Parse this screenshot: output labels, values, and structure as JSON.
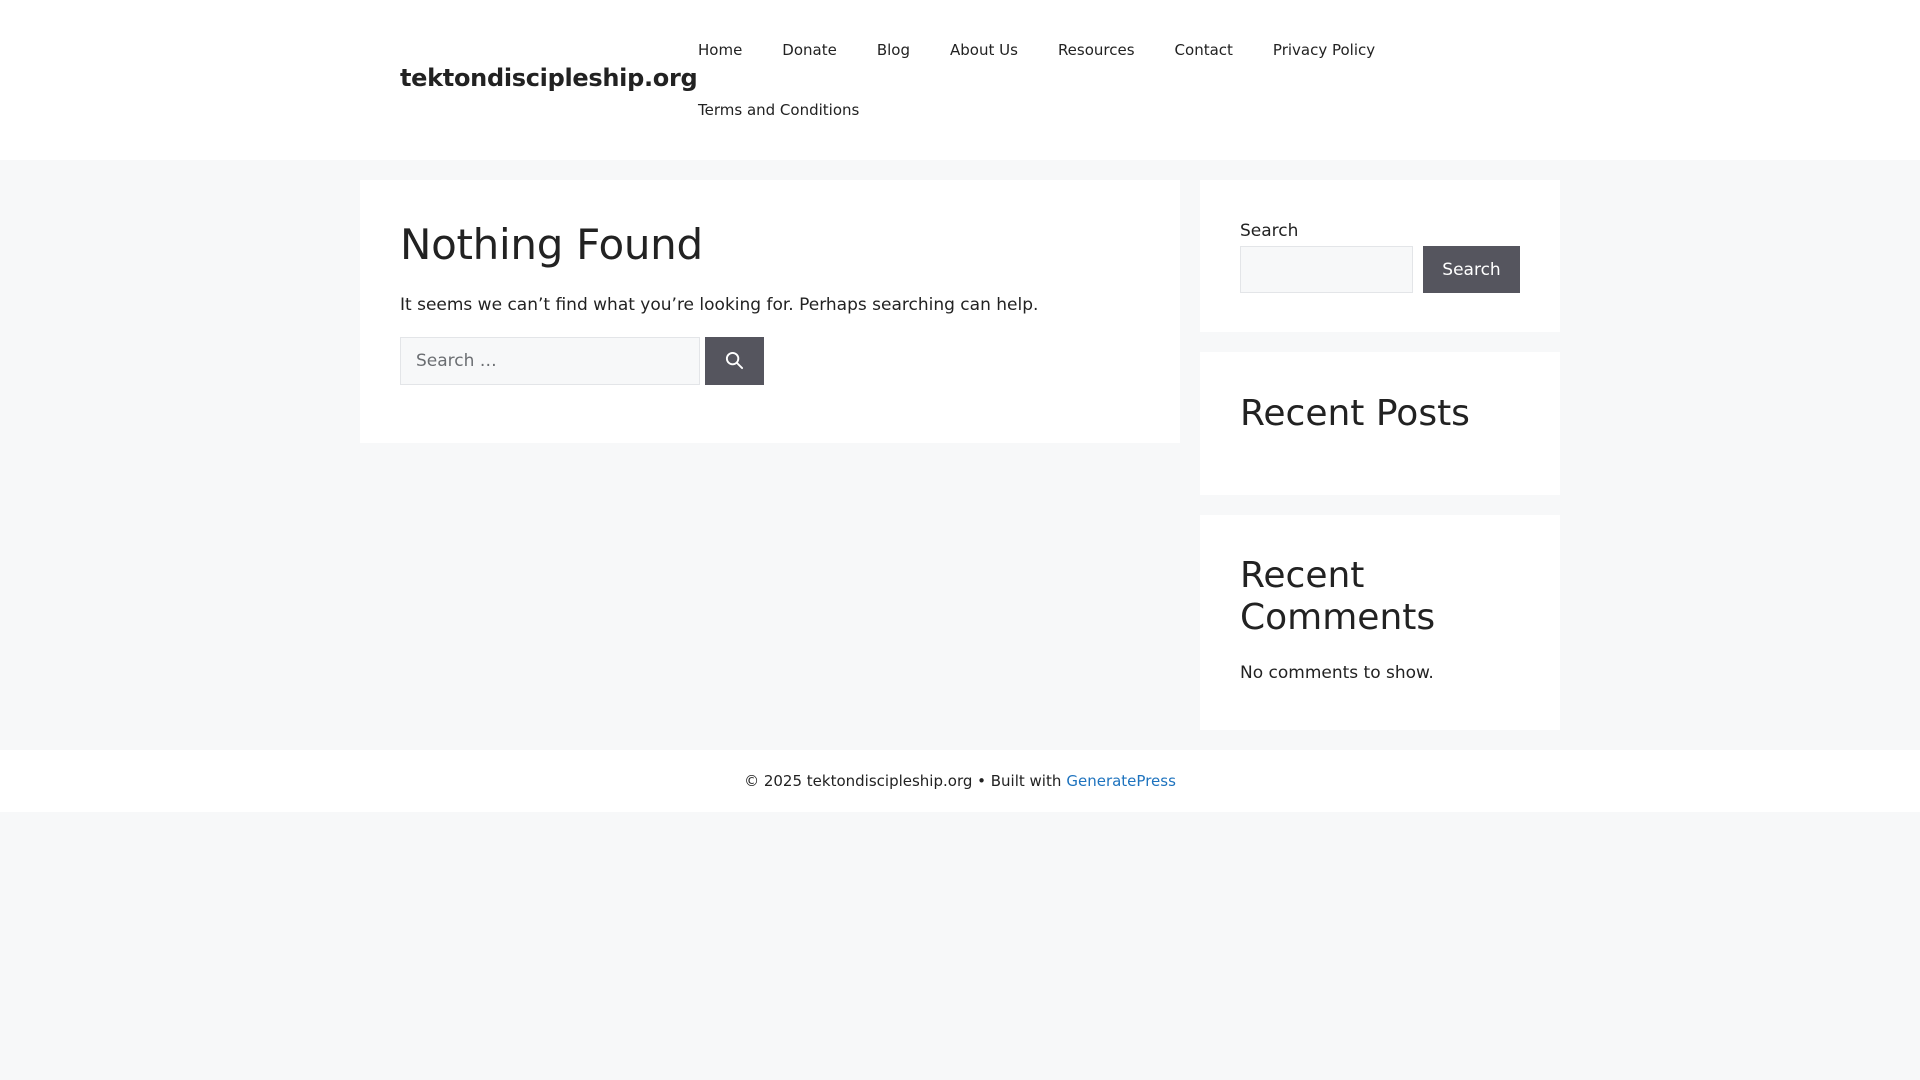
{
  "header": {
    "site_title": "tektondiscipleship.org",
    "nav": [
      {
        "label": "Home"
      },
      {
        "label": "Donate"
      },
      {
        "label": "Blog"
      },
      {
        "label": "About Us"
      },
      {
        "label": "Resources"
      },
      {
        "label": "Contact"
      },
      {
        "label": "Privacy Policy"
      },
      {
        "label": "Terms and Conditions"
      }
    ]
  },
  "main": {
    "title": "Nothing Found",
    "message": "It seems we can’t find what you’re looking for. Perhaps searching can help.",
    "search": {
      "placeholder": "Search …",
      "value": "",
      "submit_icon": "search-icon"
    }
  },
  "sidebar": {
    "search_widget": {
      "label": "Search",
      "input_value": "",
      "button_label": "Search"
    },
    "recent_posts": {
      "title": "Recent Posts"
    },
    "recent_comments": {
      "title": "Recent Comments",
      "empty_text": "No comments to show."
    }
  },
  "footer": {
    "copyright": "© 2025 tektondiscipleship.org • Built with",
    "link_text": "GeneratePress"
  },
  "colors": {
    "page_background": "#f7f8f9",
    "panel_background": "#ffffff",
    "button_background": "#55555e",
    "link": "#1e73be",
    "text": "#222222"
  }
}
